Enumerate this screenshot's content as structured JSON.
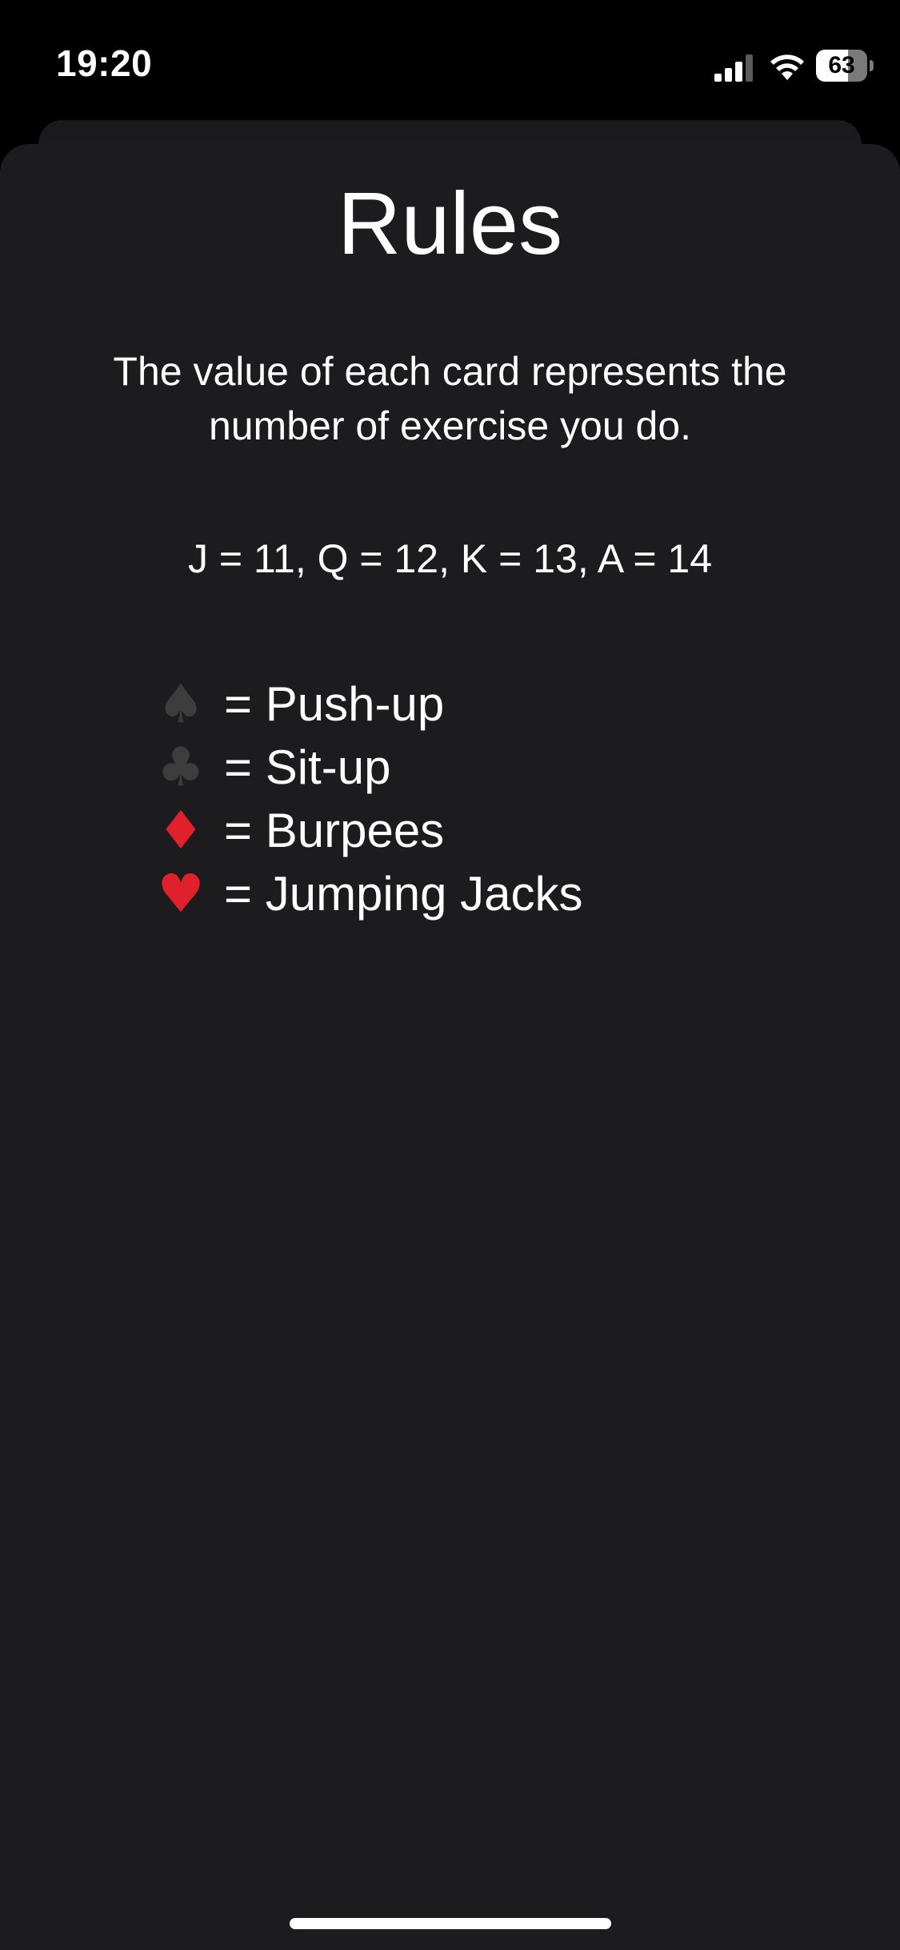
{
  "status_bar": {
    "time": "19:20",
    "battery_level": "63",
    "battery_fraction": 0.63
  },
  "rules": {
    "title": "Rules",
    "description": "The value of each card represents the number of exercise you do.",
    "values_line": "J = 11, Q = 12, K = 13, A = 14",
    "suits": [
      {
        "glyph": "♠",
        "icon": "spade-icon",
        "label": "= Push-up",
        "color": "#3d3d3d"
      },
      {
        "glyph": "♣",
        "icon": "club-icon",
        "label": "= Sit-up",
        "color": "#3d3d3d"
      },
      {
        "glyph": "♦",
        "icon": "diamond-icon",
        "label": "= Burpees",
        "color": "#e0202a"
      },
      {
        "glyph": "♥",
        "icon": "heart-icon",
        "label": "= Jumping Jacks",
        "color": "#e0202a"
      }
    ]
  },
  "colors": {
    "background": "#000000",
    "sheet": "#1c1c1e",
    "text": "#ffffff",
    "red_suit": "#e0202a"
  }
}
